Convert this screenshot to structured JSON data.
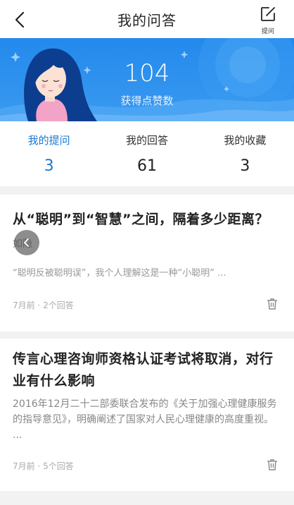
{
  "header": {
    "title": "我的问答",
    "ask_label": "提问"
  },
  "hero": {
    "likes_count": "104",
    "likes_label": "获得点赞数"
  },
  "tabs": [
    {
      "label": "我的提问",
      "count": "3",
      "active": true
    },
    {
      "label": "我的回答",
      "count": "61",
      "active": false
    },
    {
      "label": "我的收藏",
      "count": "3",
      "active": false
    }
  ],
  "questions": [
    {
      "title": "从“聪明”到“智慧”之间，隔着多少距离？",
      "author": "如隐",
      "excerpt": "“聪明反被聪明误”，我个人理解这是一种“小聪明” ...",
      "meta": "7月前 · 2个回答"
    },
    {
      "title": "传言心理咨询师资格认证考试将取消，对行业有什么影响",
      "excerpt": "2016年12月二十二部委联合发布的《关于加强心理健康服务的指导意见》，明确阐述了国家对人民心理健康的高度重视。 ...",
      "meta": "7月前 · 5个回答"
    }
  ],
  "colors": {
    "accent": "#1a7ad6",
    "hero_bg": "#1f82e6"
  },
  "icons": {
    "back": "chevron-left-icon",
    "ask": "edit-square-icon",
    "delete": "trash-icon",
    "overlay": "chevron-left-icon"
  }
}
